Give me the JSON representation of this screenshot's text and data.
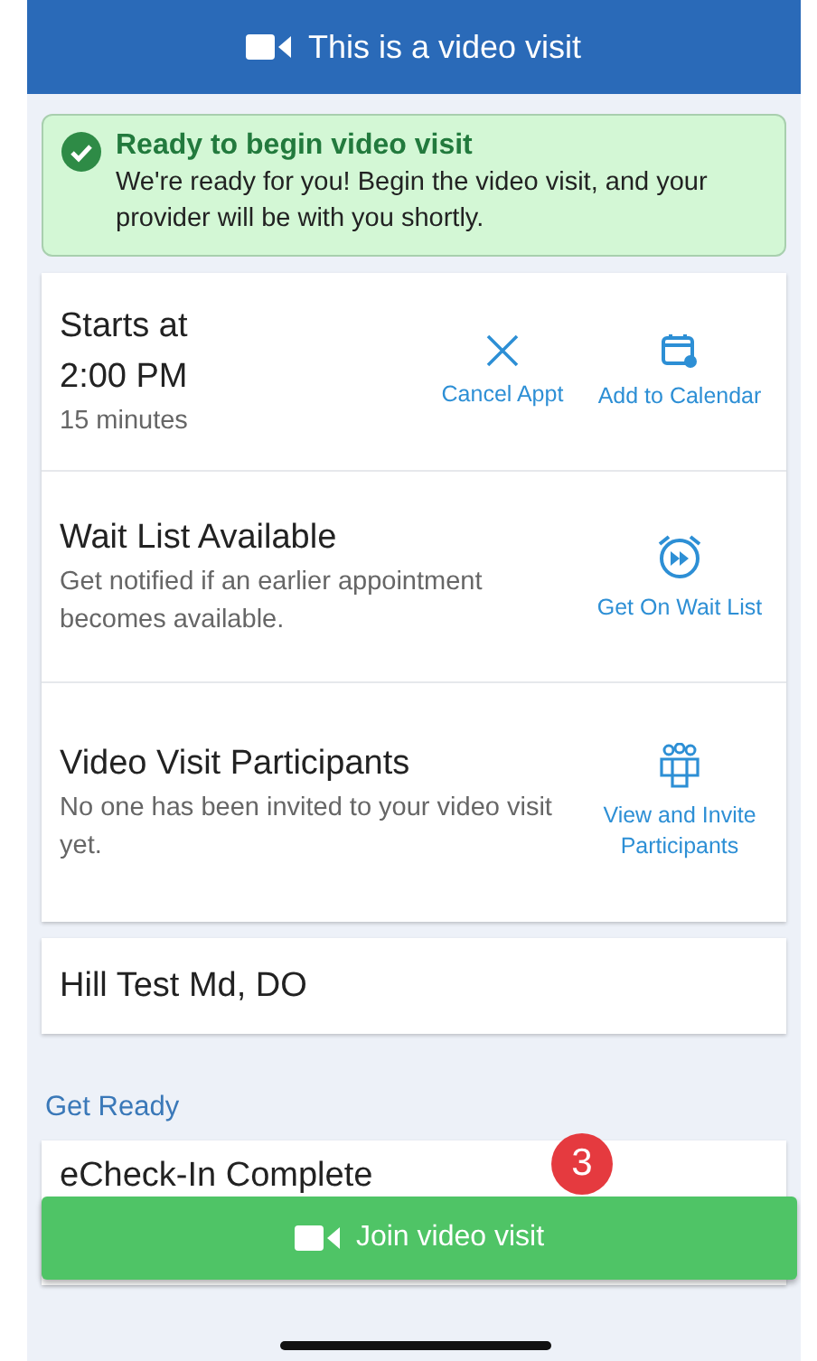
{
  "header": {
    "title": "This is a video visit"
  },
  "alert": {
    "title": "Ready to begin video visit",
    "message": "We're ready for you! Begin the video visit, and your provider will be with you shortly."
  },
  "appointment": {
    "starts_label": "Starts at",
    "time": "2:00 PM",
    "duration": "15 minutes",
    "actions": [
      {
        "label": "Cancel Appt",
        "kind": "cancel"
      },
      {
        "label": "Add to Calendar",
        "kind": "calendar"
      }
    ]
  },
  "sections": [
    {
      "title": "Wait List Available",
      "description": "Get notified if an earlier appointment becomes available.",
      "action": {
        "label": "Get On Wait List",
        "kind": "waitlist"
      }
    },
    {
      "title": "Video Visit Participants",
      "description": "No one has been invited to your video visit yet.",
      "action": {
        "label": "View and Invite Participants",
        "kind": "participants"
      }
    }
  ],
  "provider": "Hill Test Md, DO",
  "get_ready": {
    "heading": "Get Ready",
    "item_title": "eCheck-In Complete"
  },
  "join_button": {
    "label": "Join video visit",
    "badge": "3"
  }
}
